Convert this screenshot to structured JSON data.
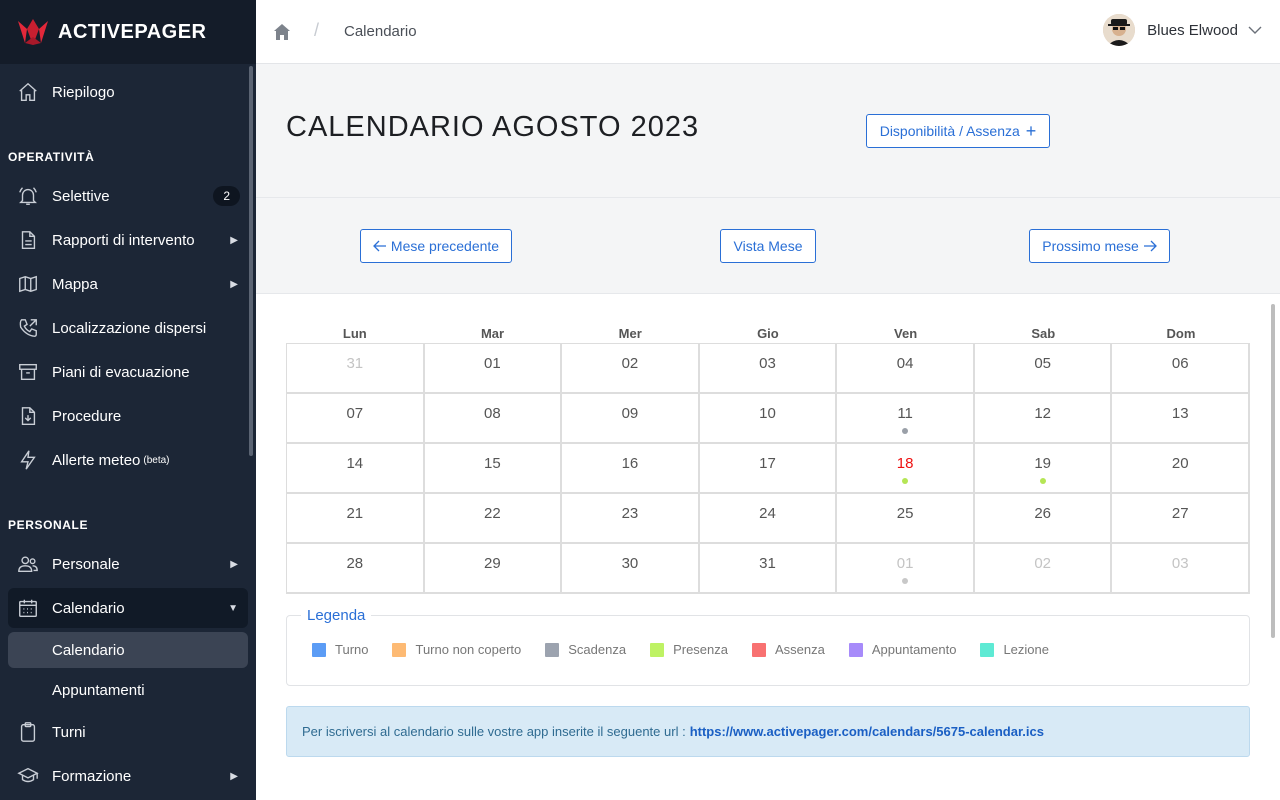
{
  "brand": {
    "name": "ACTIVEPAGER"
  },
  "sidebar": {
    "top_item": {
      "label": "Riepilogo",
      "icon": "home-icon"
    },
    "section_operativita": "OPERATIVITÀ",
    "operativita": [
      {
        "label": "Selettive",
        "icon": "bell-icon",
        "badge": "2"
      },
      {
        "label": "Rapporti di intervento",
        "icon": "document-icon",
        "arrow": "▶"
      },
      {
        "label": "Mappa",
        "icon": "map-icon",
        "arrow": "▶"
      },
      {
        "label": "Localizzazione dispersi",
        "icon": "phone-icon"
      },
      {
        "label": "Piani di evacuazione",
        "icon": "archive-icon"
      },
      {
        "label": "Procedure",
        "icon": "download-file-icon"
      },
      {
        "label": "Allerte meteo",
        "sup": "(beta)",
        "icon": "lightning-icon"
      }
    ],
    "section_personale": "PERSONALE",
    "personale": [
      {
        "label": "Personale",
        "icon": "users-icon",
        "arrow": "▶"
      },
      {
        "label": "Calendario",
        "icon": "calendar-icon",
        "arrow": "▼"
      }
    ],
    "calendario_sub": [
      {
        "label": "Calendario"
      },
      {
        "label": "Appuntamenti"
      }
    ],
    "bottom": [
      {
        "label": "Turni",
        "icon": "clipboard-icon"
      },
      {
        "label": "Formazione",
        "icon": "graduation-cap-icon",
        "arrow": "▶"
      }
    ]
  },
  "header": {
    "breadcrumb": "Calendario",
    "separator": "/",
    "user_name": "Blues Elwood"
  },
  "page": {
    "title": "CALENDARIO AGOSTO 2023",
    "availability_button": "Disponibilità / Assenza",
    "availability_plus": "+",
    "prev_button": "Mese precedente",
    "view_button": "Vista Mese",
    "next_button": "Prossimo mese"
  },
  "calendar": {
    "weekdays": [
      "Lun",
      "Mar",
      "Mer",
      "Gio",
      "Ven",
      "Sab",
      "Dom"
    ],
    "weeks": [
      [
        {
          "d": "31",
          "m": true
        },
        {
          "d": "01"
        },
        {
          "d": "02"
        },
        {
          "d": "03"
        },
        {
          "d": "04"
        },
        {
          "d": "05"
        },
        {
          "d": "06"
        }
      ],
      [
        {
          "d": "07"
        },
        {
          "d": "08"
        },
        {
          "d": "09"
        },
        {
          "d": "10"
        },
        {
          "d": "11",
          "dot": "#9aa0a8"
        },
        {
          "d": "12"
        },
        {
          "d": "13"
        }
      ],
      [
        {
          "d": "14"
        },
        {
          "d": "15"
        },
        {
          "d": "16"
        },
        {
          "d": "17"
        },
        {
          "d": "18",
          "today": true,
          "dot": "#b5e655"
        },
        {
          "d": "19",
          "dot": "#b5e655"
        },
        {
          "d": "20"
        }
      ],
      [
        {
          "d": "21"
        },
        {
          "d": "22"
        },
        {
          "d": "23"
        },
        {
          "d": "24"
        },
        {
          "d": "25"
        },
        {
          "d": "26"
        },
        {
          "d": "27"
        }
      ],
      [
        {
          "d": "28"
        },
        {
          "d": "29"
        },
        {
          "d": "30"
        },
        {
          "d": "31"
        },
        {
          "d": "01",
          "m": true,
          "dot": "#c8c8c8"
        },
        {
          "d": "02",
          "m": true
        },
        {
          "d": "03",
          "m": true
        }
      ]
    ]
  },
  "legend": {
    "title": "Legenda",
    "items": [
      {
        "label": "Turno",
        "color": "#5b9cf5"
      },
      {
        "label": "Turno non coperto",
        "color": "#fdba74"
      },
      {
        "label": "Scadenza",
        "color": "#9ca3af"
      },
      {
        "label": "Presenza",
        "color": "#bef264"
      },
      {
        "label": "Assenza",
        "color": "#f87171"
      },
      {
        "label": "Appuntamento",
        "color": "#a78bfa"
      },
      {
        "label": "Lezione",
        "color": "#5eead4"
      }
    ]
  },
  "info": {
    "text": "Per iscriversi al calendario sulle vostre app inserite il seguente url :",
    "url": "https://www.activepager.com/calendars/5675-calendar.ics"
  }
}
